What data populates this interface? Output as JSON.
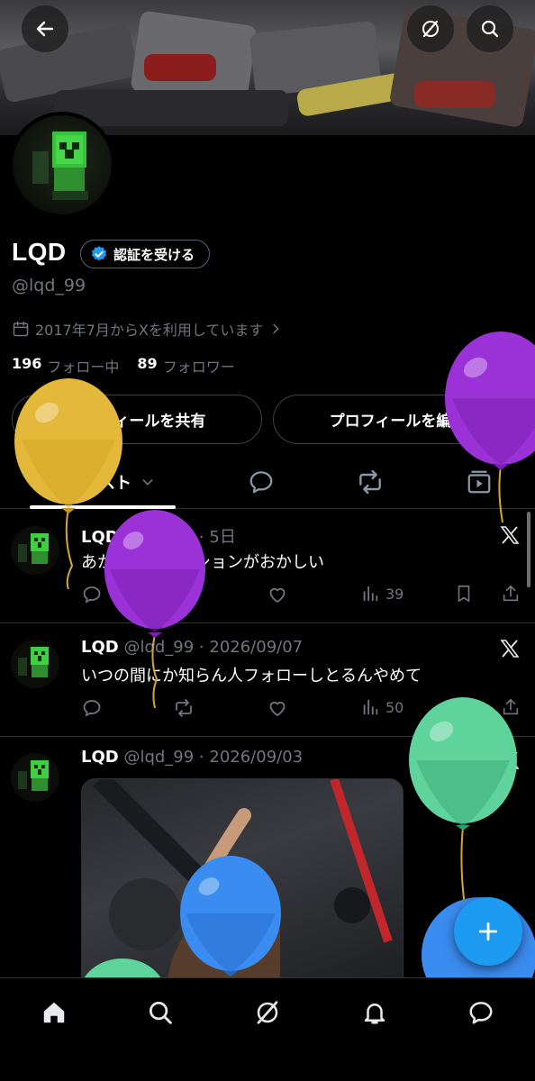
{
  "profile": {
    "name": "LQD",
    "verify_label": "認証を受ける",
    "handle": "@lqd_99",
    "joined": "2017年7月からXを利用しています",
    "following_count": "196",
    "following_label": "フォロー中",
    "followers_count": "89",
    "followers_label": "フォロワー",
    "share_label": "プロフィールを共有",
    "edit_label": "プロフィールを編集"
  },
  "tabs": {
    "posts_label": "ポスト"
  },
  "posts": [
    {
      "name": "LQD",
      "meta": "@lqd_99 · 5日",
      "text": "あかん最近テンションがおかしい",
      "views": "39"
    },
    {
      "name": "LQD",
      "meta": "@lqd_99 · 2026/09/07",
      "text": "いつの間にか知らん人フォローしとるんやめて",
      "views": "50"
    },
    {
      "name": "LQD",
      "meta": "@lqd_99 · 2026/09/03",
      "text": ""
    }
  ],
  "icons": [
    "back-icon",
    "grok-icon",
    "search-icon",
    "verified-badge-icon",
    "calendar-icon",
    "chevron-right-icon",
    "posts-icon",
    "chevron-down-icon",
    "replies-icon",
    "repost-icon",
    "media-icon",
    "reply-icon",
    "like-icon",
    "views-icon",
    "bookmark-icon",
    "share-icon",
    "x-logo-icon",
    "home-icon",
    "notifications-icon",
    "messages-icon",
    "compose-icon"
  ],
  "colors": {
    "background": "#000000",
    "accent": "#1d9bf0",
    "text": "#e7e9ea",
    "muted": "#71767b",
    "balloon_yellow": "#e4b83a",
    "balloon_purple": "#9b32d8",
    "balloon_green": "#5fd39c",
    "balloon_blue": "#3b8cf0"
  }
}
